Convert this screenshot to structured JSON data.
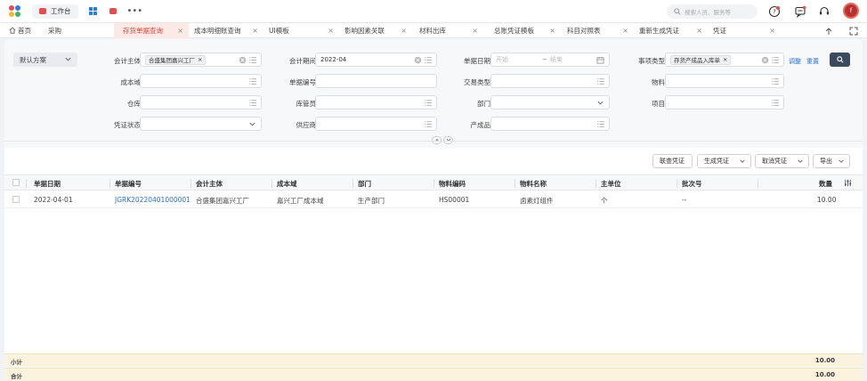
{
  "topbar": {
    "workbench_label": "工作台",
    "more_label": "•••",
    "search_placeholder": "搜索人员、服务等",
    "avatar_letter": "f",
    "brand_colors": [
      "#e34d4d",
      "#2d7be5",
      "#f5b82e",
      "#3bb46e"
    ]
  },
  "tabs": [
    {
      "label": "首页",
      "active": false,
      "icon": "home-icon"
    },
    {
      "label": "采购",
      "active": false
    },
    {
      "label": "存货单据查询",
      "active": true
    },
    {
      "label": "成本明细账查询",
      "active": false
    },
    {
      "label": "UI模板",
      "active": false
    },
    {
      "label": "影响因素关联",
      "active": false
    },
    {
      "label": "材料出库",
      "active": false
    },
    {
      "label": "总账凭证模板",
      "active": false
    },
    {
      "label": "科目对照表",
      "active": false
    },
    {
      "label": "重新生成凭证",
      "active": false
    },
    {
      "label": "凭证",
      "active": false
    }
  ],
  "filters": {
    "scheme_label": "默认方案",
    "accounting_entity": {
      "label": "会计主体",
      "value": "合盛集团嘉兴工厂"
    },
    "accounting_period": {
      "label": "会计期间",
      "value": "2022-04"
    },
    "doc_date": {
      "label": "单据日期",
      "start_placeholder": "开始",
      "separator": "~",
      "end_placeholder": "结束"
    },
    "event_type": {
      "label": "事项类型",
      "value": "存货产成品入库单"
    },
    "adjust_link": "调整",
    "reset_link": "重置",
    "cost_domain": {
      "label": "成本域"
    },
    "doc_number": {
      "label": "单据编号"
    },
    "trade_type": {
      "label": "交易类型"
    },
    "material": {
      "label": "物料"
    },
    "warehouse": {
      "label": "仓库"
    },
    "storekeeper": {
      "label": "库管员"
    },
    "department": {
      "label": "部门"
    },
    "project": {
      "label": "项目"
    },
    "voucher_status": {
      "label": "凭证状态"
    },
    "supplier": {
      "label": "供应商"
    },
    "product": {
      "label": "产成品"
    }
  },
  "actions": {
    "link_voucher": "联查凭证",
    "generate_voucher": "生成凭证",
    "cancel_voucher": "取消凭证",
    "export": "导出"
  },
  "table": {
    "columns": [
      "单据日期",
      "单据编号",
      "会计主体",
      "成本域",
      "部门",
      "物料编码",
      "物料名称",
      "主单位",
      "批次号",
      "数量"
    ],
    "rows": [
      [
        "2022-04-01",
        "JGRK20220401000001",
        "合盛集团嘉兴工厂",
        "嘉兴工厂成本域",
        "生产部门",
        "HS00001",
        "卤素灯组件",
        "个",
        "--",
        "10.00"
      ]
    ],
    "subtotal_label": "小计",
    "subtotal_value": "10.00",
    "total_label": "合计",
    "total_value": "10.00"
  }
}
